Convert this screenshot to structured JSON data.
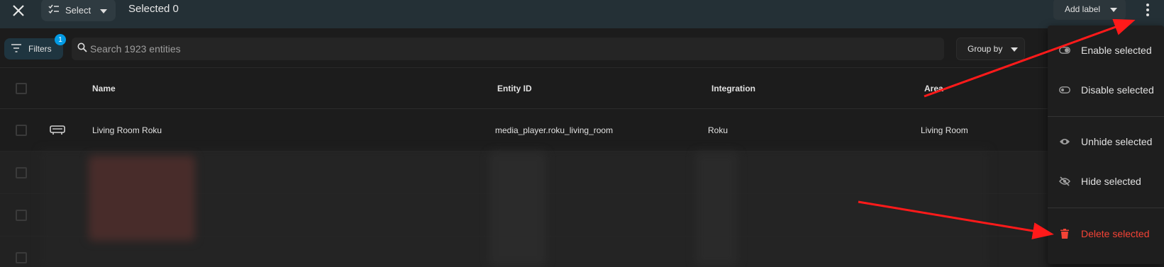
{
  "topbar": {
    "select_label": "Select",
    "selected_text": "Selected 0",
    "add_label": "Add label"
  },
  "search": {
    "filters_label": "Filters",
    "filters_count": "1",
    "placeholder": "Search 1923 entities",
    "group_by_label": "Group by"
  },
  "table": {
    "columns": [
      "Name",
      "Entity ID",
      "Integration",
      "Area"
    ],
    "rows": [
      {
        "icon": "tv-icon",
        "name": "Living Room Roku",
        "entity_id": "media_player.roku_living_room",
        "integration": "Roku",
        "area": "Living Room"
      }
    ]
  },
  "menu": {
    "items": [
      {
        "label": "Enable selected",
        "icon": "toggle-on-icon"
      },
      {
        "label": "Disable selected",
        "icon": "toggle-off-icon"
      },
      {
        "label": "Unhide selected",
        "icon": "eye-icon"
      },
      {
        "label": "Hide selected",
        "icon": "eye-off-icon"
      },
      {
        "label": "Delete selected",
        "icon": "trash-icon"
      }
    ]
  },
  "colors": {
    "topbar": "#243036",
    "badge": "#039be5",
    "danger": "#f44336",
    "annotation_arrow": "#ff1a1a"
  }
}
